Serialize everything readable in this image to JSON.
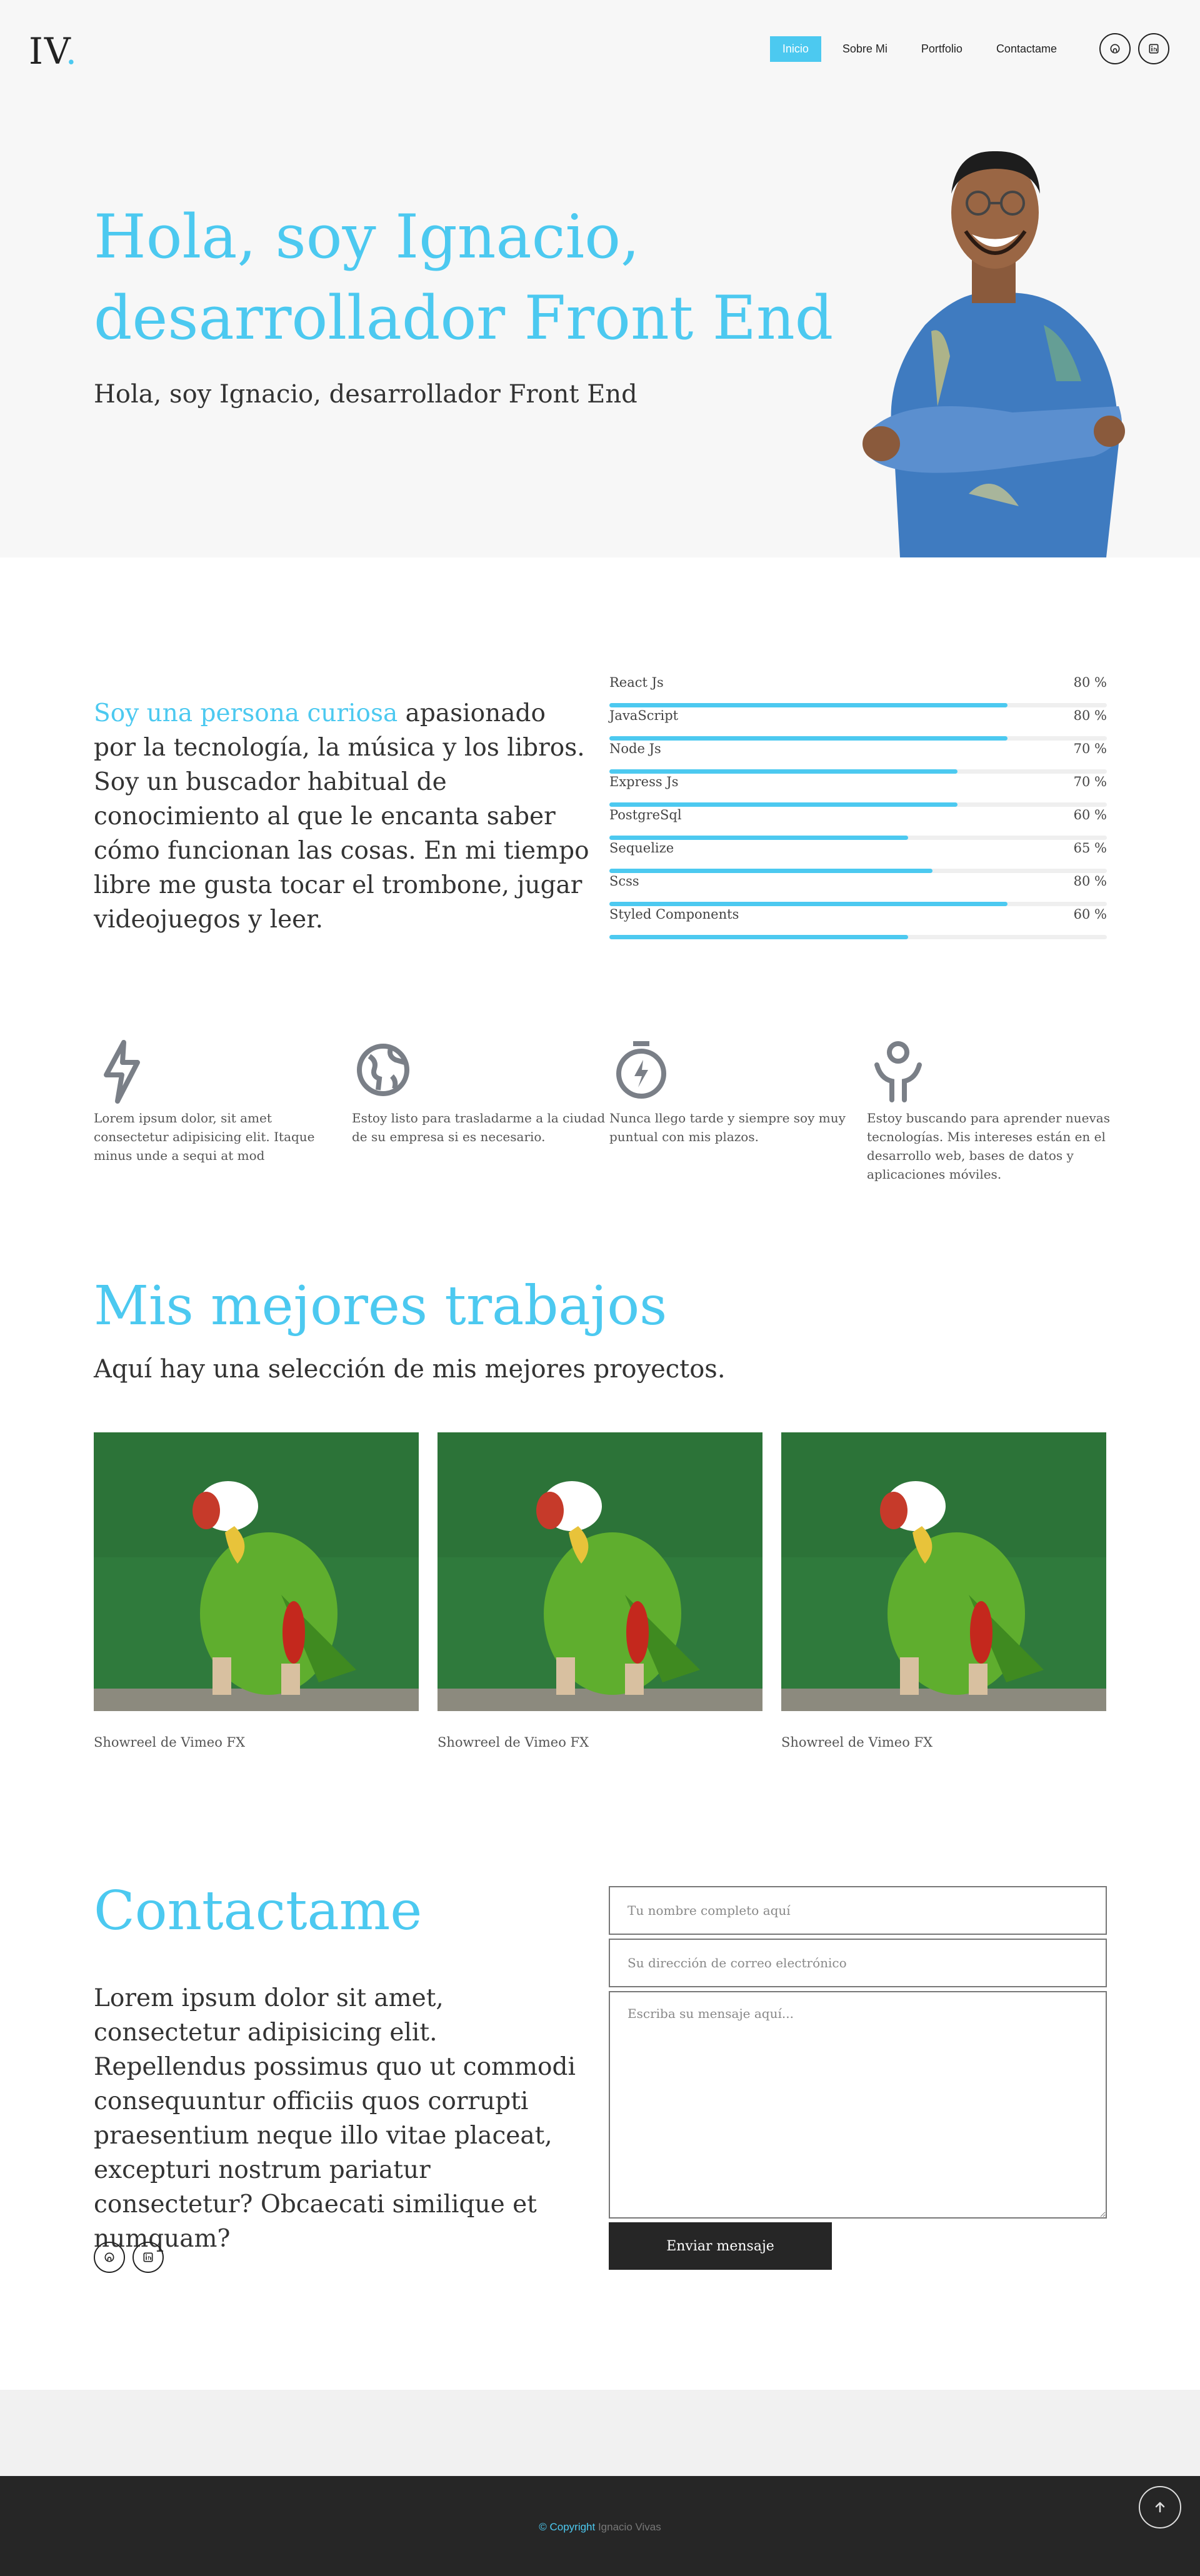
{
  "header": {
    "logo_text": "IV",
    "logo_dot": ".",
    "nav": [
      {
        "label": "Inicio",
        "active": true
      },
      {
        "label": "Sobre Mi",
        "active": false
      },
      {
        "label": "Portfolio",
        "active": false
      },
      {
        "label": "Contactame",
        "active": false
      }
    ],
    "social_icons": [
      "github-icon",
      "linkedin-icon"
    ]
  },
  "hero": {
    "title": "Hola, soy Ignacio, desarrollador Front End",
    "subtitle": "Hola, soy Ignacio, desarrollador Front End"
  },
  "about": {
    "highlight": "Soy una persona curiosa",
    "text": " apasionado por la tecnología, la música y los libros. Soy un buscador habitual de conocimiento al que le encanta saber cómo funcionan las cosas. En mi tiempo libre me gusta tocar el trombone, jugar videojuegos y leer.",
    "skills": [
      {
        "name": "React Js",
        "percent_label": "80 %",
        "level": 0.8
      },
      {
        "name": "JavaScript",
        "percent_label": "80 %",
        "level": 0.8
      },
      {
        "name": "Node Js",
        "percent_label": "70 %",
        "level": 0.7
      },
      {
        "name": "Express Js",
        "percent_label": "70 %",
        "level": 0.7
      },
      {
        "name": "PostgreSql",
        "percent_label": "60 %",
        "level": 0.6
      },
      {
        "name": "Sequelize",
        "percent_label": "65 %",
        "level": 0.65
      },
      {
        "name": "Scss",
        "percent_label": "80 %",
        "level": 0.8
      },
      {
        "name": "Styled Components",
        "percent_label": "60 %",
        "level": 0.6
      }
    ]
  },
  "features": [
    {
      "icon": "lightning-icon",
      "text": "Lorem ipsum dolor, sit amet consectetur adipisicing elit. Itaque minus unde a sequi at mod"
    },
    {
      "icon": "globe-icon",
      "text": "Estoy listo para trasladarme a la ciudad de su empresa si es necesario."
    },
    {
      "icon": "stopwatch-icon",
      "text": "Nunca llego tarde y siempre soy muy puntual con mis plazos."
    },
    {
      "icon": "person-idea-icon",
      "text": "Estoy buscando para aprender nuevas tecnologías. Mis intereses están en el desarrollo web, bases de datos y aplicaciones móviles."
    }
  ],
  "portfolio": {
    "title": "Mis mejores trabajos",
    "subtitle": "Aquí hay una selección de mis mejores proyectos.",
    "items": [
      {
        "caption": "Showreel de Vimeo FX"
      },
      {
        "caption": "Showreel de Vimeo FX"
      },
      {
        "caption": "Showreel de Vimeo FX"
      }
    ]
  },
  "contact": {
    "title": "Contactame",
    "text": "Lorem ipsum dolor sit amet, consectetur adipisicing elit. Repellendus possimus quo ut commodi consequuntur officiis quos corrupti praesentium neque illo vitae placeat, excepturi nostrum pariatur consectetur? Obcaecati similique et numquam?",
    "name_placeholder": "Tu nombre completo aquí",
    "email_placeholder": "Su dirección de correo electrónico",
    "message_placeholder": "Escriba su mensaje aquí...",
    "submit_label": "Enviar mensaje"
  },
  "footer": {
    "copyright_label": "© Copyright",
    "copyright_name": " Ignacio Vivas",
    "top_icon": "arrow-up-icon"
  },
  "colors": {
    "accent": "#4cc9f0",
    "dark": "#262626"
  }
}
